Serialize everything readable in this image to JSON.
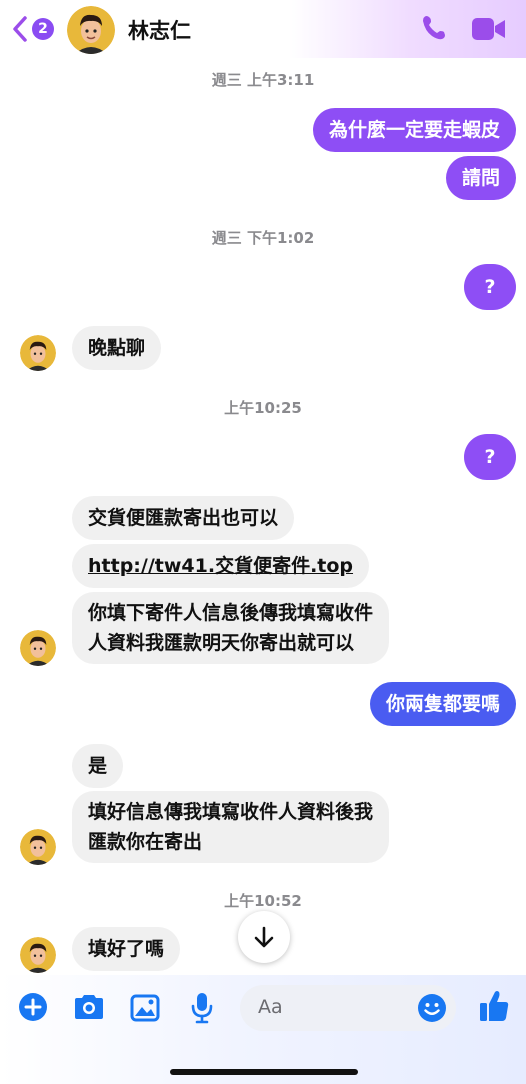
{
  "header": {
    "back_badge": "2",
    "contact_name": "林志仁"
  },
  "messages": {
    "stamp1": "週三 上午3:11",
    "out1": "為什麼一定要走蝦皮",
    "out2": "請問",
    "stamp2": "週三 下午1:02",
    "out3": "?",
    "in1": "晚點聊",
    "stamp3": "上午10:25",
    "out4": "?",
    "in2": "交貨便匯款寄出也可以",
    "in3": "http://tw41.交貨便寄件.top",
    "in4_line1": "你填下寄件人信息後傳我填寫收件",
    "in4_line2": "人資料我匯款明天你寄出就可以",
    "out5": "你兩隻都要嗎",
    "in5": "是",
    "in6_line1": "填好信息傳我填寫收件人資料後我",
    "in6_line2": "匯款你在寄出",
    "stamp4": "上午10:52",
    "in7": "填好了嗎"
  },
  "composer": {
    "placeholder": "Aa"
  },
  "colors": {
    "purple": "#8e4ef5",
    "blue": "#4a5cf1",
    "accent_icon": "#1877f2",
    "header_icon": "#9b4dea"
  },
  "icons": [
    "back-chevron-icon",
    "phone-icon",
    "video-icon",
    "plus-icon",
    "camera-icon",
    "image-icon",
    "microphone-icon",
    "emoji-icon",
    "thumbs-up-icon",
    "arrow-down-icon"
  ]
}
